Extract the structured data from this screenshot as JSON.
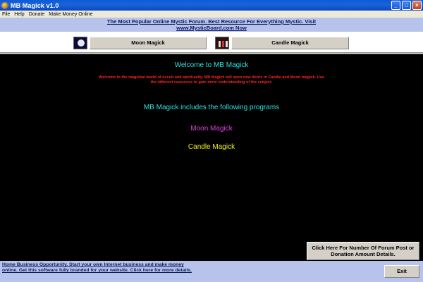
{
  "window": {
    "title": "MB Magick v1.0",
    "icon": "app-logo-icon",
    "controls": [
      "minimize-icon",
      "maximize-icon",
      "close-icon"
    ],
    "control_glyphs": {
      "minimize": "_",
      "maximize": "□",
      "close": "×"
    }
  },
  "menu": {
    "items": [
      "File",
      "Help",
      "Donate",
      "Make Money Online"
    ]
  },
  "banner": {
    "line1": "The Most Popular Online Mystic Forum. Best Resource For Everything Mystic. Visit",
    "line2": "www.MysticBoard.com Now"
  },
  "programs_bar": {
    "moon_label": "Moon Magick",
    "candle_label": "Candle Magick",
    "moon_icon": "moon-icon",
    "candle_icon": "candles-icon"
  },
  "main": {
    "welcome_title": "Welcome to MB Magick",
    "welcome_text": "Welcome to the magickal world of occult and spirituality. MB Magick will open new doors in Candle and Moon magick. Use the different resources to gain more understanding of the subject.",
    "programs_heading": "MB Magick includes the following programs",
    "moon_link": "Moon Magick",
    "candle_link": "Candle Magick",
    "forum_button": "Click Here For Number Of Forum Post or Donation Amount Details."
  },
  "footer": {
    "promo_text": "Home Business Opportunity. Start your own Internet business and make money online. Get this software fully branded for your website. Click here for more details.",
    "exit_label": "Exit"
  },
  "colors": {
    "main_background": "#000000",
    "banner_background": "#b8c3ec",
    "title_color": "#2fe0e0",
    "description_color": "#ff2020",
    "moon_link_color": "#e040e0",
    "candle_link_color": "#f0f020"
  }
}
